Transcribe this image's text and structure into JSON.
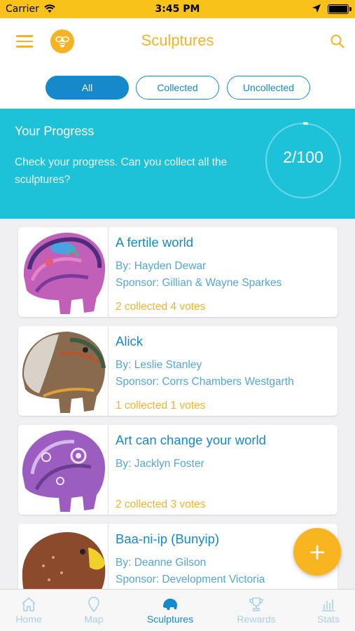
{
  "status": {
    "carrier": "Carrier",
    "time": "3:45 PM"
  },
  "header": {
    "title": "Sculptures",
    "logo": "bee-icon",
    "menu": "hamburger-icon",
    "search": "search-icon"
  },
  "filters": {
    "all": "All",
    "collected": "Collected",
    "uncollected": "Uncollected",
    "active": "All"
  },
  "progress": {
    "title": "Your Progress",
    "description": "Check your progress. Can you collect all the sculptures?",
    "count": "2/100",
    "fraction": 0.02
  },
  "sculptures": [
    {
      "name": "A fertile world",
      "by": "By: Hayden Dewar",
      "sponsor": "Sponsor: Gillian & Wayne Sparkes",
      "stats": "2 collected 4 votes"
    },
    {
      "name": "Alick",
      "by": "By: Leslie Stanley",
      "sponsor": "Sponsor: Corrs Chambers Westgarth",
      "stats": "1 collected 1 votes"
    },
    {
      "name": "Art can change your world",
      "by": "By: Jacklyn Foster",
      "sponsor": "",
      "stats": "2 collected 3 votes"
    },
    {
      "name": "Baa-ni-ip (Bunyip)",
      "by": "By: Deanne Gilson",
      "sponsor": "Sponsor: Development Victoria",
      "stats": ""
    }
  ],
  "fab": {
    "label": "+"
  },
  "tabs": {
    "home": "Home",
    "map": "Map",
    "sculptures": "Sculptures",
    "rewards": "Rewards",
    "stats": "Stats",
    "active": "Sculptures"
  },
  "colors": {
    "brand_yellow": "#f5b324",
    "brand_blue": "#1589c9",
    "progress_teal": "#1ec2d8"
  }
}
